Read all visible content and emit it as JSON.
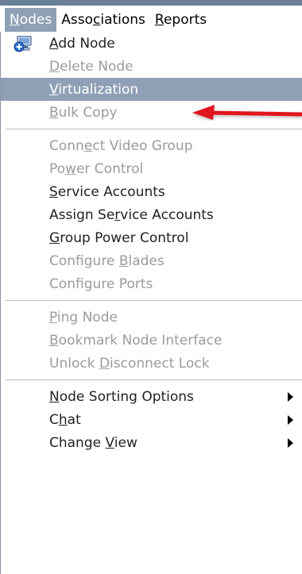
{
  "menubar": {
    "items": [
      {
        "before": "",
        "u": "N",
        "after": "odes",
        "active": true
      },
      {
        "before": "Asso",
        "u": "c",
        "after": "iations",
        "active": false
      },
      {
        "before": "",
        "u": "R",
        "after": "eports",
        "active": false
      }
    ]
  },
  "menu": {
    "rows": [
      {
        "kind": "item",
        "before": "",
        "u": "A",
        "after": "dd Node",
        "enabled": true,
        "highlight": false,
        "submenu": false,
        "icon": "add-node-icon"
      },
      {
        "kind": "item",
        "before": "",
        "u": "D",
        "after": "elete Node",
        "enabled": false,
        "highlight": false,
        "submenu": false
      },
      {
        "kind": "item",
        "before": "",
        "u": "V",
        "after": "irtualization",
        "enabled": true,
        "highlight": true,
        "submenu": false
      },
      {
        "kind": "item",
        "before": "",
        "u": "B",
        "after": "ulk Copy",
        "enabled": false,
        "highlight": false,
        "submenu": false
      },
      {
        "kind": "sep"
      },
      {
        "kind": "item",
        "before": "Conn",
        "u": "e",
        "after": "ct Video Group",
        "enabled": false,
        "highlight": false,
        "submenu": false
      },
      {
        "kind": "item",
        "before": "Po",
        "u": "w",
        "after": "er Control",
        "enabled": false,
        "highlight": false,
        "submenu": false
      },
      {
        "kind": "item",
        "before": "",
        "u": "S",
        "after": "ervice Accounts",
        "enabled": true,
        "highlight": false,
        "submenu": false
      },
      {
        "kind": "item",
        "before": "Assign Se",
        "u": "r",
        "after": "vice Accounts",
        "enabled": true,
        "highlight": false,
        "submenu": false
      },
      {
        "kind": "item",
        "before": "",
        "u": "G",
        "after": "roup Power Control",
        "enabled": true,
        "highlight": false,
        "submenu": false
      },
      {
        "kind": "item",
        "before": "Configure ",
        "u": "B",
        "after": "lades",
        "enabled": false,
        "highlight": false,
        "submenu": false
      },
      {
        "kind": "item",
        "before": "Configure Ports",
        "u": "",
        "after": "",
        "enabled": false,
        "highlight": false,
        "submenu": false
      },
      {
        "kind": "sep"
      },
      {
        "kind": "item",
        "before": "",
        "u": "P",
        "after": "ing Node",
        "enabled": false,
        "highlight": false,
        "submenu": false
      },
      {
        "kind": "item",
        "before": "",
        "u": "B",
        "after": "ookmark Node Interface",
        "enabled": false,
        "highlight": false,
        "submenu": false
      },
      {
        "kind": "item",
        "before": "Unlock ",
        "u": "D",
        "after": "isconnect Lock",
        "enabled": false,
        "highlight": false,
        "submenu": false
      },
      {
        "kind": "sep"
      },
      {
        "kind": "item",
        "before": "",
        "u": "N",
        "after": "ode Sorting Options",
        "enabled": true,
        "highlight": false,
        "submenu": true
      },
      {
        "kind": "item",
        "before": "C",
        "u": "h",
        "after": "at",
        "enabled": true,
        "highlight": false,
        "submenu": true
      },
      {
        "kind": "item",
        "before": "Change ",
        "u": "V",
        "after": "iew",
        "enabled": true,
        "highlight": false,
        "submenu": true
      }
    ]
  },
  "annotation": {
    "arrow_color": "#e0151b",
    "target": "Virtualization"
  },
  "colors": {
    "highlight_bg": "#8fa0b6",
    "disabled_text": "#9b9b9b"
  }
}
